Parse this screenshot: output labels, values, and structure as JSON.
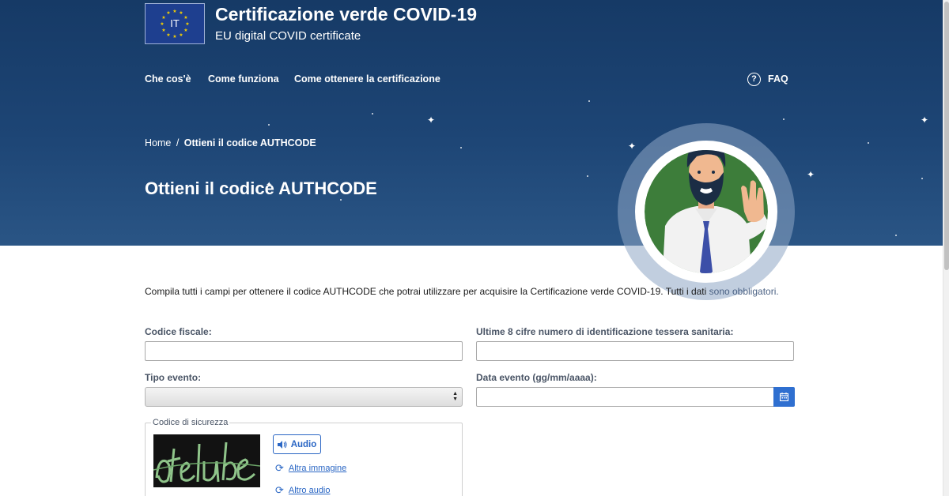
{
  "header": {
    "flag_code": "IT",
    "title": "Certificazione verde COVID-19",
    "subtitle": "EU digital COVID certificate"
  },
  "nav": {
    "items": [
      {
        "label": "Che cos'è"
      },
      {
        "label": "Come funziona"
      },
      {
        "label": "Come ottenere la certificazione"
      }
    ],
    "faq_label": "FAQ",
    "faq_icon": "help-circle-icon"
  },
  "breadcrumb": {
    "home": "Home",
    "separator": "/",
    "current": "Ottieni il codice AUTHCODE"
  },
  "page": {
    "title": "Ottieni il codice AUTHCODE"
  },
  "intro": {
    "text": "Compila tutti i campi per ottenere il codice AUTHCODE che potrai utilizzare per acquisire la Certificazione verde COVID-19. Tutti i dati",
    "link": "sono obbligatori."
  },
  "form": {
    "codice_fiscale": {
      "label": "Codice fiscale:",
      "value": ""
    },
    "tessera": {
      "label": "Ultime 8 cifre numero di identificazione tessera sanitaria:",
      "value": ""
    },
    "tipo_evento": {
      "label": "Tipo evento:",
      "selected": ""
    },
    "data_evento": {
      "label": "Data evento (gg/mm/aaaa):",
      "value": ""
    },
    "captcha": {
      "legend": "Codice di sicurezza",
      "audio_label": "Audio",
      "other_image": "Altra immagine",
      "other_audio": "Altro audio"
    }
  },
  "colors": {
    "hero_bg": "#1d4575",
    "accent_blue": "#2a66c4",
    "calendar_blue": "#2f6fd0",
    "avatar_green": "#3d7d3a"
  },
  "icons": [
    "calendar-icon",
    "speaker-icon",
    "refresh-icon",
    "help-circle-icon",
    "eu-stars-icon"
  ]
}
